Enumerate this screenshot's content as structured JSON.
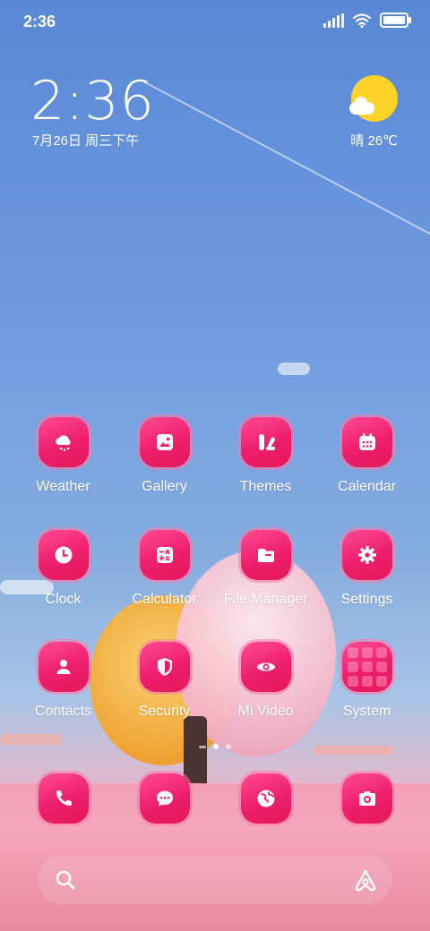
{
  "status_bar": {
    "time": "2:36"
  },
  "clock_widget": {
    "time": "2:36",
    "date": "7月26日 周三下午"
  },
  "weather_widget": {
    "text": "晴 26℃",
    "icon": "sunny-partly-cloudy-icon"
  },
  "apps": [
    {
      "label": "Weather",
      "icon": "weather-icon"
    },
    {
      "label": "Gallery",
      "icon": "gallery-icon"
    },
    {
      "label": "Themes",
      "icon": "themes-icon"
    },
    {
      "label": "Calendar",
      "icon": "calendar-icon"
    },
    {
      "label": "Clock",
      "icon": "clock-icon"
    },
    {
      "label": "Calculator",
      "icon": "calculator-icon"
    },
    {
      "label": "File Manager",
      "icon": "folder-icon"
    },
    {
      "label": "Settings",
      "icon": "gear-icon"
    },
    {
      "label": "Contacts",
      "icon": "person-icon"
    },
    {
      "label": "Security",
      "icon": "shield-icon"
    },
    {
      "label": "Mi Video",
      "icon": "eye-icon"
    },
    {
      "label": "System",
      "icon": "folder-grid-icon"
    }
  ],
  "dock": [
    {
      "icon": "phone-icon"
    },
    {
      "icon": "messages-icon"
    },
    {
      "icon": "browser-icon"
    },
    {
      "icon": "camera-icon"
    }
  ],
  "page_indicator": {
    "pages": 2,
    "active": 1
  },
  "search_bar": {
    "left_icon": "search-icon",
    "right_icon": "assistant-icon"
  },
  "colors": {
    "icon_gradient_start": "#ff4a92",
    "icon_gradient_end": "#e4195a",
    "sun": "#ffd429"
  }
}
